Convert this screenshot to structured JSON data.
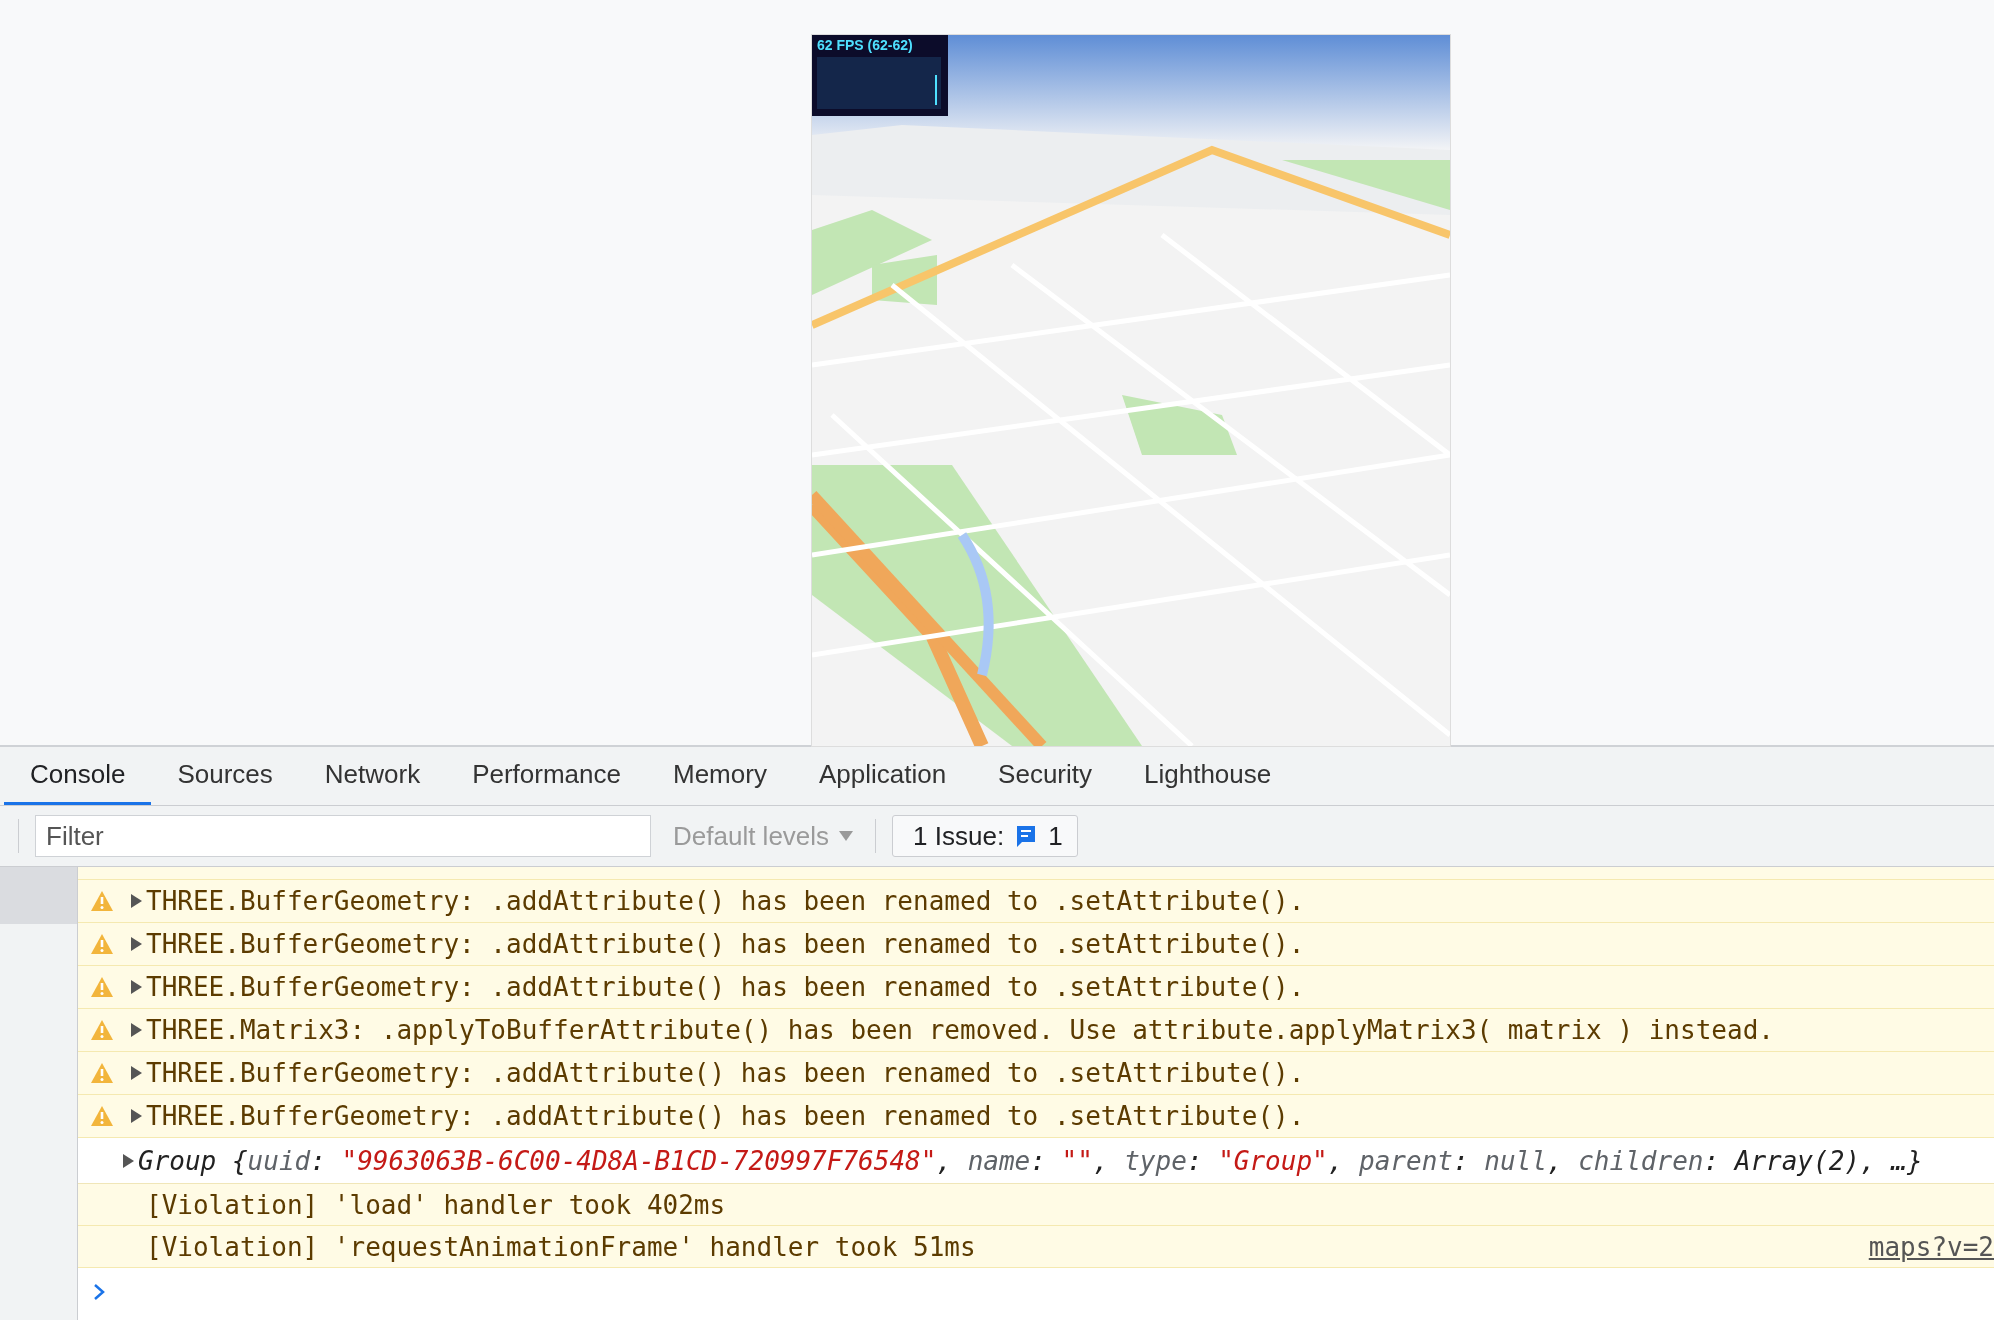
{
  "viewport": {
    "fps": "62 FPS (62-62)"
  },
  "tabs": [
    {
      "label": "Console",
      "selected": true
    },
    {
      "label": "Sources",
      "selected": false
    },
    {
      "label": "Network",
      "selected": false
    },
    {
      "label": "Performance",
      "selected": false
    },
    {
      "label": "Memory",
      "selected": false
    },
    {
      "label": "Application",
      "selected": false
    },
    {
      "label": "Security",
      "selected": false
    },
    {
      "label": "Lighthouse",
      "selected": false
    }
  ],
  "toolbar": {
    "filter": {
      "placeholder": "Filter"
    },
    "levels": "Default levels",
    "issues": {
      "label": "1 Issue:",
      "count": "1"
    }
  },
  "messages": [
    {
      "kind": "warning",
      "text": "THREE.BufferGeometry: .addAttribute() has been renamed to .setAttribute()."
    },
    {
      "kind": "warning",
      "text": "THREE.BufferGeometry: .addAttribute() has been renamed to .setAttribute()."
    },
    {
      "kind": "warning",
      "text": "THREE.BufferGeometry: .addAttribute() has been renamed to .setAttribute()."
    },
    {
      "kind": "warning",
      "text": "THREE.Matrix3: .applyToBufferAttribute() has been removed. Use attribute.applyMatrix3( matrix ) instead."
    },
    {
      "kind": "warning",
      "text": "THREE.BufferGeometry: .addAttribute() has been renamed to .setAttribute()."
    },
    {
      "kind": "warning",
      "text": "THREE.BufferGeometry: .addAttribute() has been renamed to .setAttribute()."
    },
    {
      "kind": "object",
      "parts": [
        {
          "kind": "name",
          "text": "Group "
        },
        {
          "kind": "plain",
          "text": "{"
        },
        {
          "kind": "key",
          "text": "uuid"
        },
        {
          "kind": "plain",
          "text": ": "
        },
        {
          "kind": "string",
          "text": "\"9963063B-6C00-4D8A-B1CD-720997F76548\""
        },
        {
          "kind": "plain",
          "text": ", "
        },
        {
          "kind": "key",
          "text": "name"
        },
        {
          "kind": "plain",
          "text": ": "
        },
        {
          "kind": "string",
          "text": "\"\""
        },
        {
          "kind": "plain",
          "text": ", "
        },
        {
          "kind": "key",
          "text": "type"
        },
        {
          "kind": "plain",
          "text": ": "
        },
        {
          "kind": "string",
          "text": "\"Group\""
        },
        {
          "kind": "plain",
          "text": ", "
        },
        {
          "kind": "key",
          "text": "parent"
        },
        {
          "kind": "plain",
          "text": ": "
        },
        {
          "kind": "null",
          "text": "null"
        },
        {
          "kind": "plain",
          "text": ", "
        },
        {
          "kind": "key",
          "text": "children"
        },
        {
          "kind": "plain",
          "text": ": Array(2), …}"
        }
      ]
    },
    {
      "kind": "violation",
      "text": "[Violation] 'load' handler took 402ms"
    },
    {
      "kind": "violation",
      "text": "[Violation] 'requestAnimationFrame' handler took 51ms",
      "source": "maps?v=2"
    }
  ]
}
